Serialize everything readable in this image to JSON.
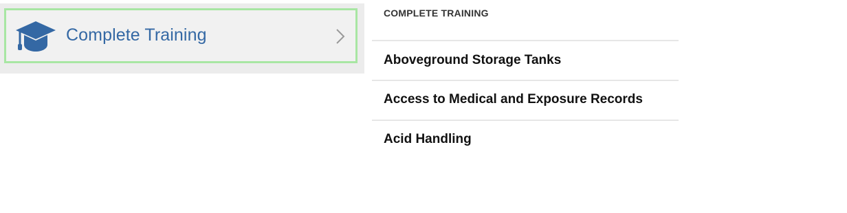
{
  "menu": {
    "item_label": "Complete Training",
    "item_icon": "graduation-cap-icon",
    "chevron_icon": "chevron-right-icon",
    "accent_color": "#3468a4",
    "highlight_border_color": "#a8e6a3"
  },
  "training_list": {
    "header": "COMPLETE TRAINING",
    "items": [
      {
        "label": "Aboveground Storage Tanks"
      },
      {
        "label": "Access to Medical and Exposure Records"
      },
      {
        "label": "Acid Handling"
      }
    ]
  }
}
